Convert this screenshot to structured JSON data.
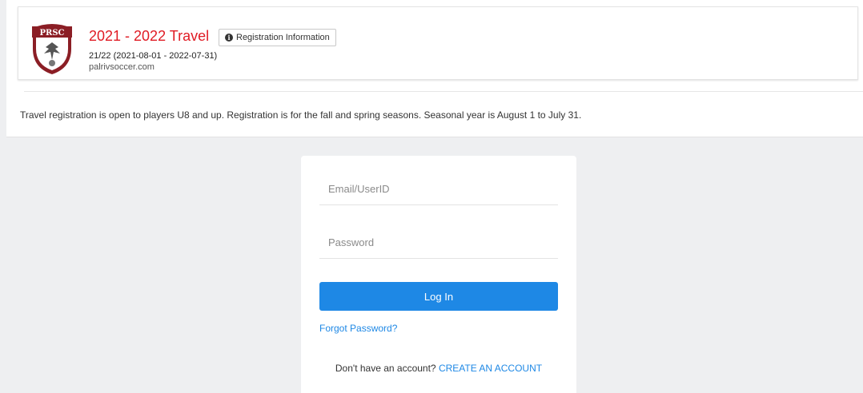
{
  "header": {
    "logo_text": "PRSC",
    "event_title": "2021 - 2022 Travel",
    "info_button_label": "Registration Information",
    "season_dates": "21/22 (2021-08-01 - 2022-07-31)",
    "website": "palrivsoccer.com",
    "accent_color": "#e01b24"
  },
  "description": "Travel registration is open to players U8 and up. Registration is for the fall and spring seasons. Seasonal year is August 1 to July 31.",
  "login": {
    "email_placeholder": "Email/UserID",
    "password_placeholder": "Password",
    "login_label": "Log In",
    "forgot_label": "Forgot Password?",
    "no_account_text": "Don't have an account?",
    "create_account_label": "CREATE AN ACCOUNT",
    "button_color": "#1e88e5"
  }
}
